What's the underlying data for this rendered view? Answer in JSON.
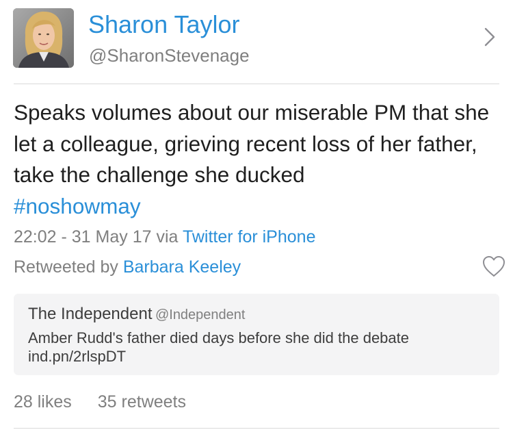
{
  "author": {
    "name": "Sharon Taylor",
    "handle": "@SharonStevenage",
    "avatar_icon": "profile-photo"
  },
  "tweet": {
    "text": "Speaks volumes about our miserable PM that she let a colleague, grieving recent loss of her father, take the challenge she ducked",
    "hashtag": "#noshowmay",
    "timestamp": "22:02 - 31 May 17",
    "via_prefix": "via",
    "source": "Twitter for iPhone"
  },
  "retweet": {
    "prefix": "Retweeted by",
    "by": "Barbara Keeley"
  },
  "quoted_tweet": {
    "name": "The Independent",
    "handle": "@Independent",
    "text_line1": "Amber Rudd's father died days before she did the debate",
    "text_line2": "ind.pn/2rlspDT"
  },
  "stats": {
    "likes": "28 likes",
    "retweets": "35 retweets"
  },
  "colors": {
    "accent": "#2a8fd8",
    "text": "#1f1f1f",
    "muted": "#7f7f7f",
    "quote_bg": "#f4f4f5"
  },
  "icons": {
    "chevron": "chevron-right-icon",
    "heart": "heart-icon"
  }
}
